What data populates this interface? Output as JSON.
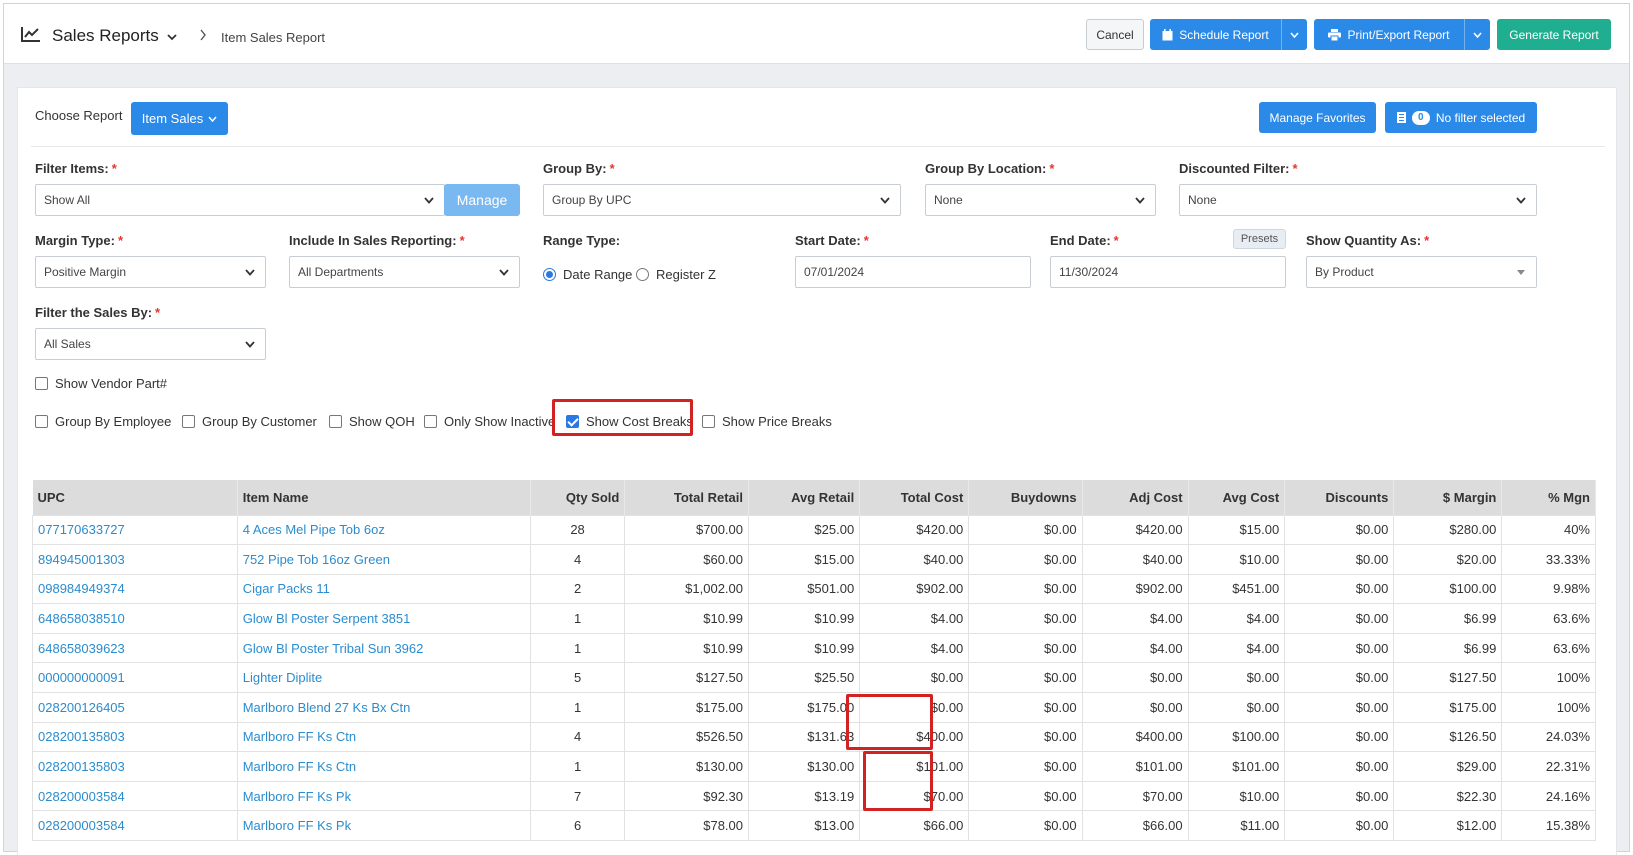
{
  "header": {
    "title": "Sales Reports",
    "breadcrumb": "Item Sales Report",
    "cancel": "Cancel",
    "schedule": "Schedule Report",
    "print": "Print/Export Report",
    "generate": "Generate Report"
  },
  "top": {
    "choose_label": "Choose Report",
    "report_value": "Item Sales",
    "manage_favorites": "Manage Favorites",
    "filter_count": "0",
    "filter_text": "No filter selected"
  },
  "filters": {
    "filter_items": {
      "label": "Filter Items:",
      "value": "Show All",
      "manage": "Manage"
    },
    "group_by": {
      "label": "Group By:",
      "value": "Group By UPC"
    },
    "group_by_location": {
      "label": "Group By Location:",
      "value": "None"
    },
    "discounted": {
      "label": "Discounted Filter:",
      "value": "None"
    },
    "margin_type": {
      "label": "Margin Type:",
      "value": "Positive Margin"
    },
    "include_sales": {
      "label": "Include In Sales Reporting:",
      "value": "All Departments"
    },
    "range_type": {
      "label": "Range Type:",
      "option1": "Date Range",
      "option2": "Register Z"
    },
    "start_date": {
      "label": "Start Date:",
      "value": "07/01/2024"
    },
    "end_date": {
      "label": "End Date:",
      "value": "11/30/2024",
      "presets": "Presets"
    },
    "show_qty": {
      "label": "Show Quantity As:",
      "value": "By Product"
    },
    "filter_sales": {
      "label": "Filter the Sales By:",
      "value": "All Sales"
    },
    "req": "*"
  },
  "checks": {
    "vendor_part": "Show Vendor Part#",
    "group_employee": "Group By Employee",
    "group_customer": "Group By Customer",
    "show_qoh": "Show QOH",
    "only_inactive": "Only Show Inactive",
    "cost_breaks": "Show Cost Breaks",
    "price_breaks": "Show Price Breaks"
  },
  "table": {
    "headers": [
      "UPC",
      "Item Name",
      "Qty Sold",
      "Total Retail",
      "Avg Retail",
      "Total Cost",
      "Buydowns",
      "Adj Cost",
      "Avg Cost",
      "Discounts",
      "$ Margin",
      "% Mgn"
    ],
    "rows": [
      [
        "077170633727",
        "4 Aces Mel Pipe Tob 6oz",
        "28",
        "$700.00",
        "$25.00",
        "$420.00",
        "$0.00",
        "$420.00",
        "$15.00",
        "$0.00",
        "$280.00",
        "40%"
      ],
      [
        "894945001303",
        "752 Pipe Tob 16oz Green",
        "4",
        "$60.00",
        "$15.00",
        "$40.00",
        "$0.00",
        "$40.00",
        "$10.00",
        "$0.00",
        "$20.00",
        "33.33%"
      ],
      [
        "098984949374",
        "Cigar Packs 11",
        "2",
        "$1,002.00",
        "$501.00",
        "$902.00",
        "$0.00",
        "$902.00",
        "$451.00",
        "$0.00",
        "$100.00",
        "9.98%"
      ],
      [
        "648658038510",
        "Glow Bl Poster Serpent 3851",
        "1",
        "$10.99",
        "$10.99",
        "$4.00",
        "$0.00",
        "$4.00",
        "$4.00",
        "$0.00",
        "$6.99",
        "63.6%"
      ],
      [
        "648658039623",
        "Glow Bl Poster Tribal Sun 3962",
        "1",
        "$10.99",
        "$10.99",
        "$4.00",
        "$0.00",
        "$4.00",
        "$4.00",
        "$0.00",
        "$6.99",
        "63.6%"
      ],
      [
        "000000000091",
        "Lighter Diplite",
        "5",
        "$127.50",
        "$25.50",
        "$0.00",
        "$0.00",
        "$0.00",
        "$0.00",
        "$0.00",
        "$127.50",
        "100%"
      ],
      [
        "028200126405",
        "Marlboro Blend 27 Ks Bx Ctn",
        "1",
        "$175.00",
        "$175.00",
        "$0.00",
        "$0.00",
        "$0.00",
        "$0.00",
        "$0.00",
        "$175.00",
        "100%"
      ],
      [
        "028200135803",
        "Marlboro FF Ks Ctn",
        "4",
        "$526.50",
        "$131.63",
        "$400.00",
        "$0.00",
        "$400.00",
        "$100.00",
        "$0.00",
        "$126.50",
        "24.03%"
      ],
      [
        "028200135803",
        "Marlboro FF Ks Ctn",
        "1",
        "$130.00",
        "$130.00",
        "$101.00",
        "$0.00",
        "$101.00",
        "$101.00",
        "$0.00",
        "$29.00",
        "22.31%"
      ],
      [
        "028200003584",
        "Marlboro FF Ks Pk",
        "7",
        "$92.30",
        "$13.19",
        "$70.00",
        "$0.00",
        "$70.00",
        "$10.00",
        "$0.00",
        "$22.30",
        "24.16%"
      ],
      [
        "028200003584",
        "Marlboro FF Ks Pk",
        "6",
        "$78.00",
        "$13.00",
        "$66.00",
        "$0.00",
        "$66.00",
        "$11.00",
        "$0.00",
        "$12.00",
        "15.38%"
      ]
    ]
  },
  "colors": {
    "primary": "#2b8ae8",
    "success": "#1fae8f",
    "highlight": "#d32222",
    "link": "#2a8ccf"
  }
}
